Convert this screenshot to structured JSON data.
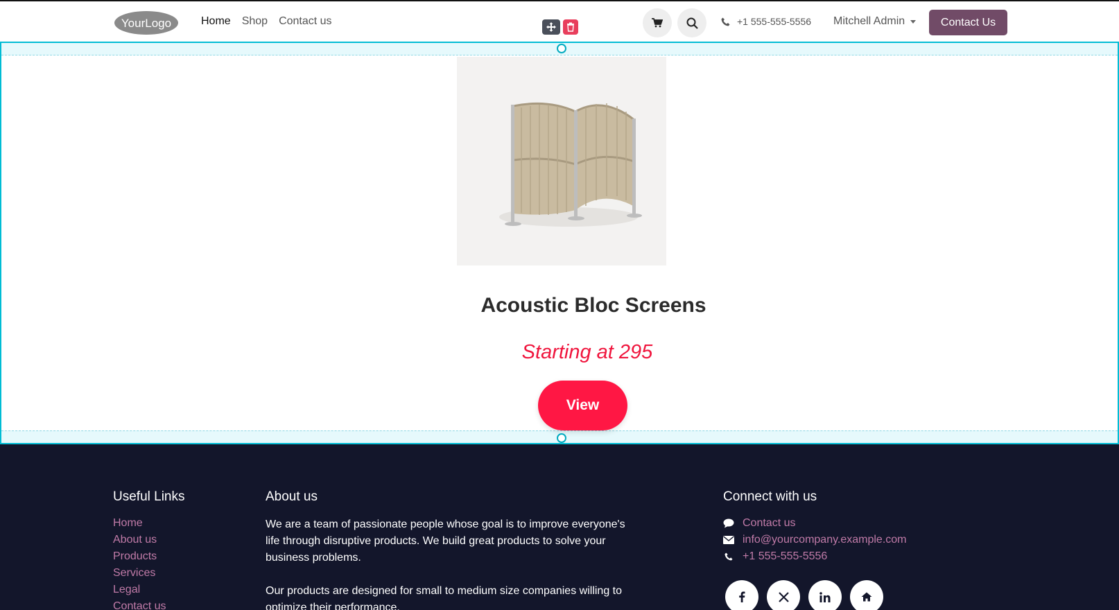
{
  "header": {
    "logo_text": "YourLogo",
    "nav": [
      {
        "label": "Home"
      },
      {
        "label": "Shop"
      },
      {
        "label": "Contact us"
      }
    ],
    "phone": "+1 555-555-5556",
    "user": "Mitchell Admin",
    "cta_label": "Contact Us"
  },
  "edit_tools": {
    "move_icon": "move-arrows-icon",
    "delete_icon": "trash-icon"
  },
  "product": {
    "title": "Acoustic Bloc Screens",
    "price_text": "Starting at 295",
    "button_label": "View",
    "image_icon": "acoustic-screen-illustration"
  },
  "footer": {
    "useful_links": {
      "heading": "Useful Links",
      "items": [
        "Home",
        "About us",
        "Products",
        "Services",
        "Legal",
        "Contact us"
      ]
    },
    "about": {
      "heading": "About us",
      "p1": "We are a team of passionate people whose goal is to improve everyone's life through disruptive products. We build great products to solve your business problems.",
      "p2": "Our products are designed for small to medium size companies willing to optimize their performance."
    },
    "connect": {
      "heading": "Connect with us",
      "contact": "Contact us",
      "email": "info@yourcompany.example.com",
      "phone": "+1 555-555-5556"
    },
    "socials": [
      "facebook-icon",
      "x-icon",
      "linkedin-icon",
      "home-icon"
    ]
  },
  "colors": {
    "brand": "#714b67",
    "accent": "#ff1744",
    "price": "#f0153d",
    "selection": "#00bcd4",
    "footer_bg": "#13162b",
    "footer_link": "#c17ba8"
  }
}
